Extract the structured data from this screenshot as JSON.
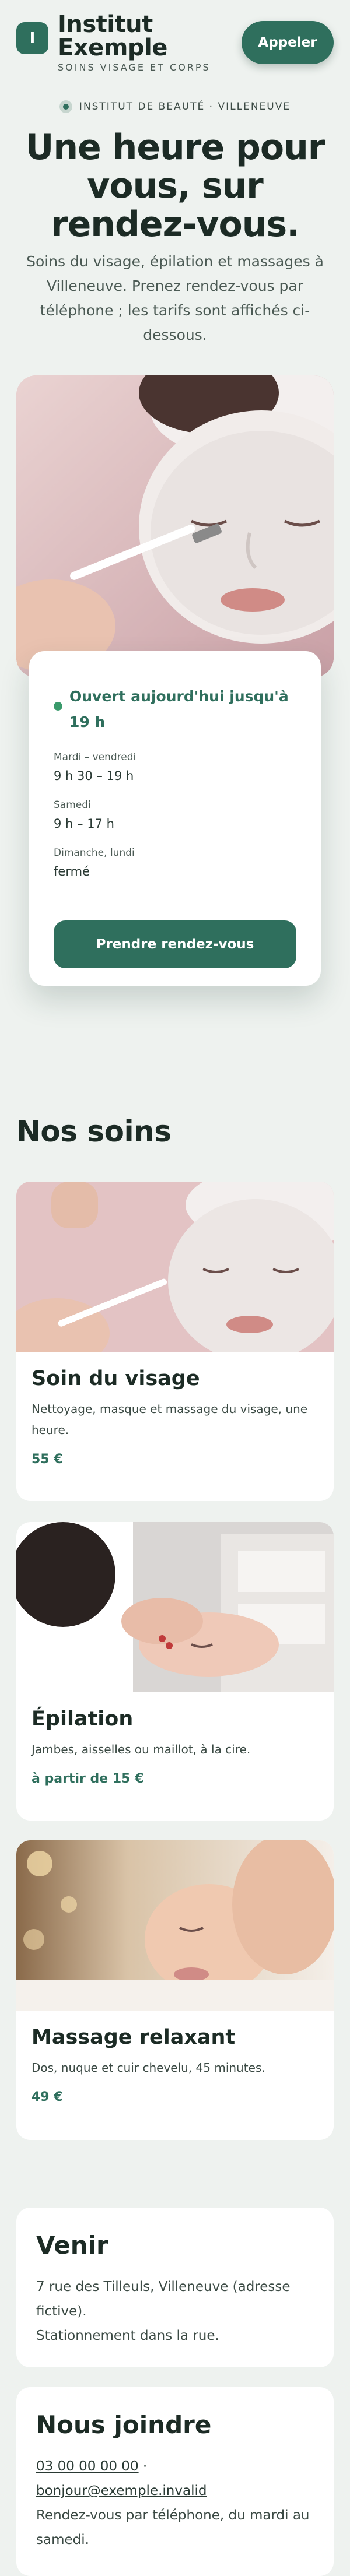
{
  "header": {
    "logo_letter": "I",
    "brand_name": "Institut Exemple",
    "tagline": "SOINS VISAGE ET CORPS",
    "call_label": "Appeler"
  },
  "hero": {
    "eyebrow": "INSTITUT DE BEAUTÉ · VILLENEUVE",
    "title": "Une heure pour vous, sur rendez-vous.",
    "subtitle": "Soins du visage, épilation et massages à Villeneuve. Prenez rendez-vous par téléphone ; les tarifs sont affichés ci-dessous."
  },
  "hours": {
    "status": "Ouvert aujourd'hui jusqu'à 19 h",
    "rows": [
      {
        "day": "Mardi – vendredi",
        "time": "9 h 30 – 19 h"
      },
      {
        "day": "Samedi",
        "time": "9 h – 17 h"
      },
      {
        "day": "Dimanche, lundi",
        "time": "fermé"
      }
    ],
    "cta": "Prendre rendez-vous"
  },
  "services": {
    "title": "Nos soins",
    "items": [
      {
        "name": "Soin du visage",
        "desc": "Nettoyage, masque et massage du visage, une heure.",
        "price": "55 €"
      },
      {
        "name": "Épilation",
        "desc": "Jambes, aisselles ou maillot, à la cire.",
        "price": "à partir de 15 €"
      },
      {
        "name": "Massage relaxant",
        "desc": "Dos, nuque et cuir chevelu, 45 minutes.",
        "price": "49 €"
      }
    ]
  },
  "venir": {
    "title": "Venir",
    "address": "7 rue des Tilleuls, Villeneuve (adresse fictive).",
    "parking": "Stationnement dans la rue."
  },
  "contact": {
    "title": "Nous joindre",
    "phone": "03 00 00 00 00",
    "separator": " ·",
    "email": "bonjour@exemple.invalid",
    "note": "Rendez-vous par téléphone, du mardi au samedi."
  },
  "colors": {
    "accent": "#2f6f5d",
    "background": "#eef2ef",
    "heading": "#1c2b25"
  }
}
